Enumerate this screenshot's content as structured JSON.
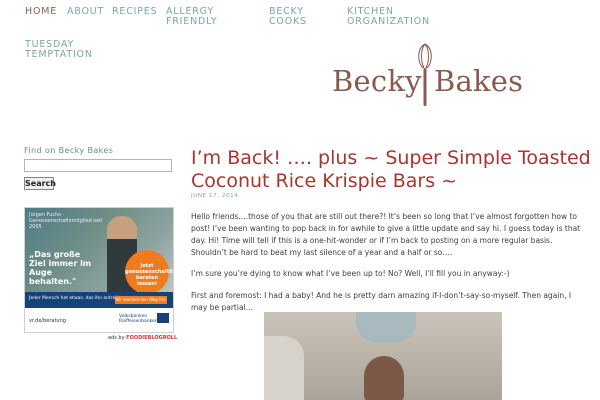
{
  "nav": {
    "items": [
      {
        "label": "HOME",
        "active": true
      },
      {
        "label": "ABOUT"
      },
      {
        "label": "RECIPES"
      },
      {
        "label": "ALLERGY FRIENDLY"
      },
      {
        "label": "BECKY COOKS"
      },
      {
        "label": "KITCHEN ORGANIZATION"
      },
      {
        "label": "TUESDAY TEMPTATION"
      }
    ]
  },
  "logo": {
    "left": "Becky",
    "right": "Bakes",
    "icon": "whisk-icon"
  },
  "sidebar": {
    "search_title": "Find on Becky Bakes",
    "search_value": "",
    "search_button": "Search"
  },
  "ad": {
    "top_text": "Jürgen Fuchs · Genossenschaftsmitglied seit 2005",
    "slogan": "„Das große Ziel immer im Auge behalten.\"",
    "badge": "Jetzt genossenschaftlich beraten lassen!",
    "bar_text": "Jeder Mensch hat etwas, das ihn antreibt.",
    "bar_button": "Wir machen den Weg frei.",
    "url": "vr.de/beratung",
    "bank": "Volksbanken Raiffeisenbanken",
    "credit_prefix": "ads by",
    "credit_brand": "FOODIEBLOGROLL"
  },
  "post": {
    "title": "I’m Back! …. plus ~ Super Simple Toasted Coconut Rice Krispie Bars ~",
    "date": "JUNE 17, 2014",
    "p1": "Hello friends….those of you that are still out there?! It’s been so long that I’ve almost forgotten how to post! I’ve been wanting to pop back in for awhile to give a little update and say hi. I guess today is that day. Hi!  Time will tell if this is a one-hit-wonder or if I’m back to posting on a more regular basis.  Shouldn’t be hard to beat my last silence of a year and a half or so….",
    "p2": "I’m sure you’re dying to know what I’ve been up to! No? Well, I’ll fill you in anyway:-)",
    "p3": "First and foremost: I had a baby! And he is pretty darn amazing if-I-don’t-say-so-myself. Then again, I may be partial…"
  },
  "colors": {
    "nav_link": "#7aa6a6",
    "nav_active": "#8c5e52",
    "post_title": "#a8362e",
    "logo": "#8a5a4e"
  }
}
